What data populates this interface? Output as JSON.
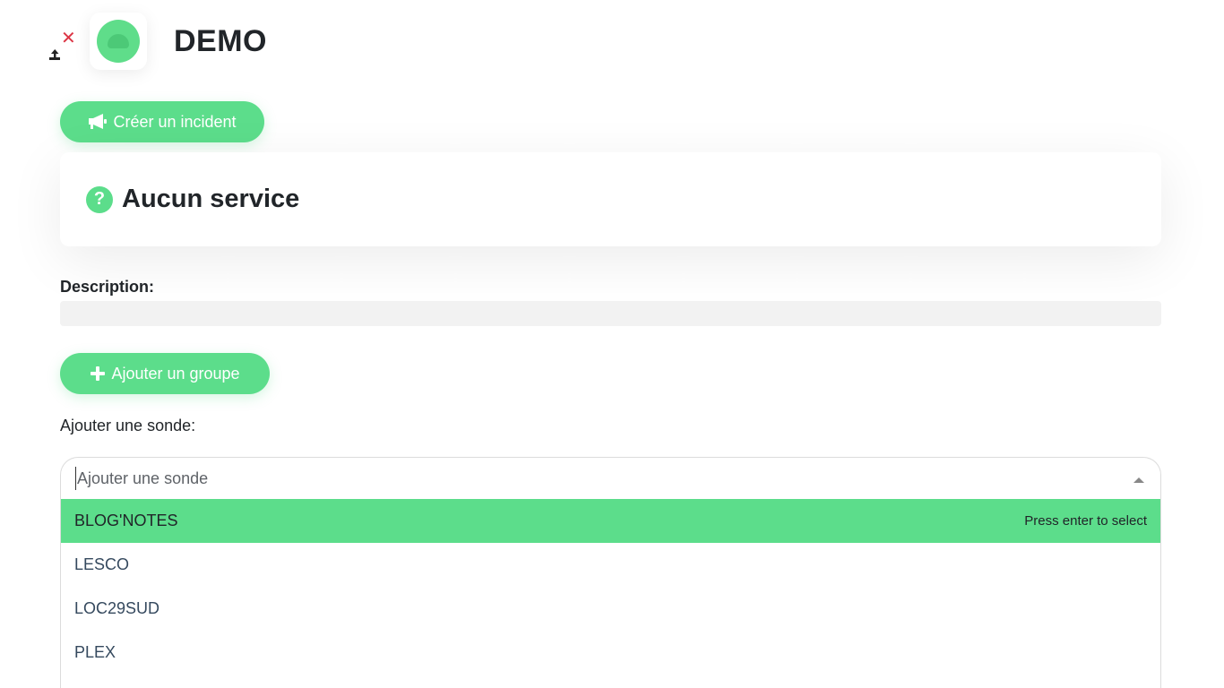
{
  "header": {
    "title": "DEMO",
    "remove_glyph": "✕",
    "icons": [
      "close-icon",
      "upload-icon"
    ]
  },
  "buttons": {
    "create_incident": "Créer un incident",
    "add_group": "Ajouter un groupe"
  },
  "service_card": {
    "title": "Aucun service",
    "icon_glyph": "?"
  },
  "description": {
    "label": "Description:",
    "value": ""
  },
  "probe": {
    "label": "Ajouter une sonde:",
    "placeholder": "Ajouter une sonde",
    "options": [
      {
        "label": "BLOG'NOTES",
        "highlighted": true
      },
      {
        "label": "LESCO",
        "highlighted": false
      },
      {
        "label": "LOC29SUD",
        "highlighted": false
      },
      {
        "label": "PLEX",
        "highlighted": false
      }
    ],
    "select_hint": "Press enter to select"
  },
  "colors": {
    "accent": "#5cdd8b",
    "danger": "#dc3545",
    "text": "#212529"
  }
}
